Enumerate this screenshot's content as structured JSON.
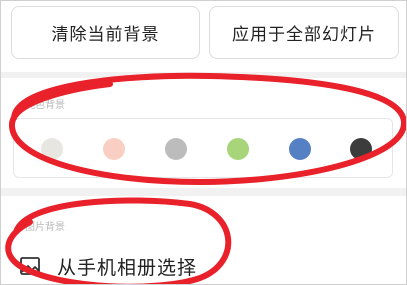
{
  "toolbar": {
    "clear_label": "清除当前背景",
    "apply_all_label": "应用于全部幻灯片"
  },
  "solid_color": {
    "section_label": "纯色背景",
    "swatches": [
      {
        "name": "swatch-light-gray",
        "color": "#e8e6e1"
      },
      {
        "name": "swatch-peach",
        "color": "#f9cfc4"
      },
      {
        "name": "swatch-gray",
        "color": "#bcbcbc"
      },
      {
        "name": "swatch-green",
        "color": "#a8d47a"
      },
      {
        "name": "swatch-blue",
        "color": "#5581c4"
      },
      {
        "name": "swatch-dark",
        "color": "#3c3c3c"
      }
    ]
  },
  "picture": {
    "section_label": "图片背景",
    "album_label": "从手机相册选择",
    "album_icon": "image-icon"
  },
  "colors": {
    "annotation": "#e8212a"
  }
}
